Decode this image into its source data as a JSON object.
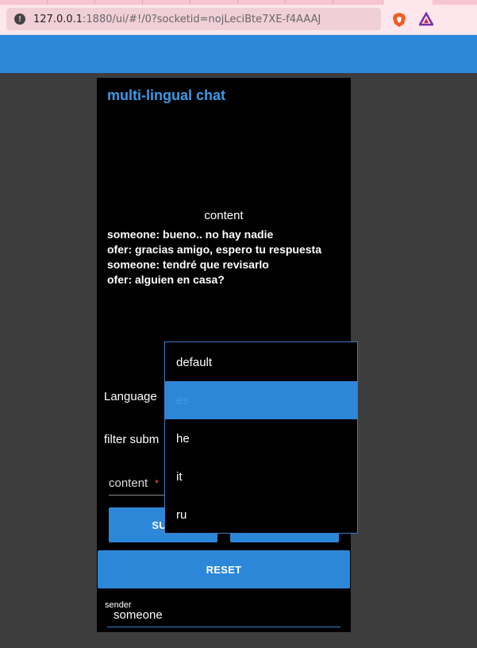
{
  "browser": {
    "url": "127.0.0.1:1880/ui/#!/0?socketid=nojLeciBte7XE-f4AAAJ",
    "url_host": "127.0.0.1",
    "url_rest": ":1880/ui/#!/0?socketid=nojLeciBte7XE-f4AAAJ",
    "icons": [
      "info-icon",
      "brave-shield-icon",
      "brave-rewards-icon"
    ]
  },
  "app": {
    "header_color": "#2d87d8",
    "title": "multi-lingual chat",
    "content_label": "content",
    "messages": [
      "someone: bueno.. no hay nadie",
      "ofer: gracias amigo, espero tu respuesta",
      "someone: tendré que revisarlo",
      "ofer: alguien en casa?"
    ],
    "language_label": "Language",
    "filter_label": "filter subm",
    "content_input": {
      "placeholder": "content",
      "required_mark": "*",
      "value": ""
    },
    "submit_label": "SUB",
    "other_label": "",
    "reset_label": "RESET",
    "sender": {
      "label": "sender",
      "value": "someone"
    }
  },
  "language_dropdown": {
    "options": [
      "default",
      "es",
      "he",
      "it",
      "ru"
    ],
    "selected": "es"
  },
  "colors": {
    "accent": "#2d87d8",
    "title": "#3b9be9",
    "background": "#3d3d3d",
    "card": "#000000"
  }
}
